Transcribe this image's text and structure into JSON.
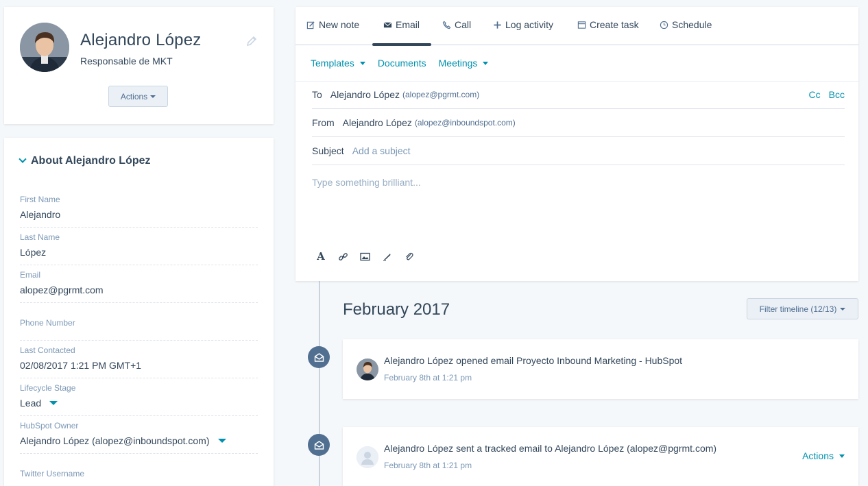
{
  "profile": {
    "name": "Alejandro López",
    "title": "Responsable de MKT",
    "actions_label": "Actions"
  },
  "about": {
    "header": "About Alejandro López",
    "properties": [
      {
        "label": "First Name",
        "value": "Alejandro"
      },
      {
        "label": "Last Name",
        "value": "López"
      },
      {
        "label": "Email",
        "value": "alopez@pgrmt.com"
      },
      {
        "label": "Phone Number",
        "value": ""
      },
      {
        "label": "Last Contacted",
        "value": "02/08/2017 1:21 PM GMT+1"
      },
      {
        "label": "Lifecycle Stage",
        "value": "Lead"
      },
      {
        "label": "HubSpot Owner",
        "value": "Alejandro López (alopez@inboundspot.com)"
      },
      {
        "label": "Twitter Username",
        "value": ""
      }
    ]
  },
  "compose": {
    "tabs": [
      {
        "label": "New note",
        "icon": "note-icon"
      },
      {
        "label": "Email",
        "icon": "envelope-icon"
      },
      {
        "label": "Call",
        "icon": "phone-icon"
      },
      {
        "label": "Log activity",
        "icon": "plus-icon"
      },
      {
        "label": "Create task",
        "icon": "task-icon"
      },
      {
        "label": "Schedule",
        "icon": "clock-icon"
      }
    ],
    "active_tab": "Email",
    "sub_links": {
      "templates": "Templates",
      "documents": "Documents",
      "meetings": "Meetings"
    },
    "to": {
      "label": "To",
      "name": "Alejandro López",
      "email": "(alopez@pgrmt.com)"
    },
    "cc": "Cc",
    "bcc": "Bcc",
    "from": {
      "label": "From",
      "name": "Alejandro López",
      "email": "(alopez@inboundspot.com)"
    },
    "subject": {
      "label": "Subject",
      "placeholder": "Add a subject"
    },
    "body_placeholder": "Type something brilliant..."
  },
  "timeline": {
    "month": "February 2017",
    "filter_label": "Filter timeline (12/13)",
    "events": [
      {
        "actor": "Alejandro López",
        "action": "opened email",
        "object": "Proyecto Inbound Marketing - HubSpot",
        "time": "February 8th at 1:21 pm"
      },
      {
        "actor": "Alejandro López",
        "action": "sent a tracked email to",
        "object": "Alejandro López",
        "object_email": "(alopez@pgrmt.com)",
        "time": "February 8th at 1:21 pm",
        "actions_label": "Actions"
      }
    ]
  },
  "colors": {
    "accent": "#0091ae",
    "text": "#33475b",
    "muted": "#7c98b6",
    "background": "#f5f8fa",
    "timeline_dot": "#516f90"
  }
}
